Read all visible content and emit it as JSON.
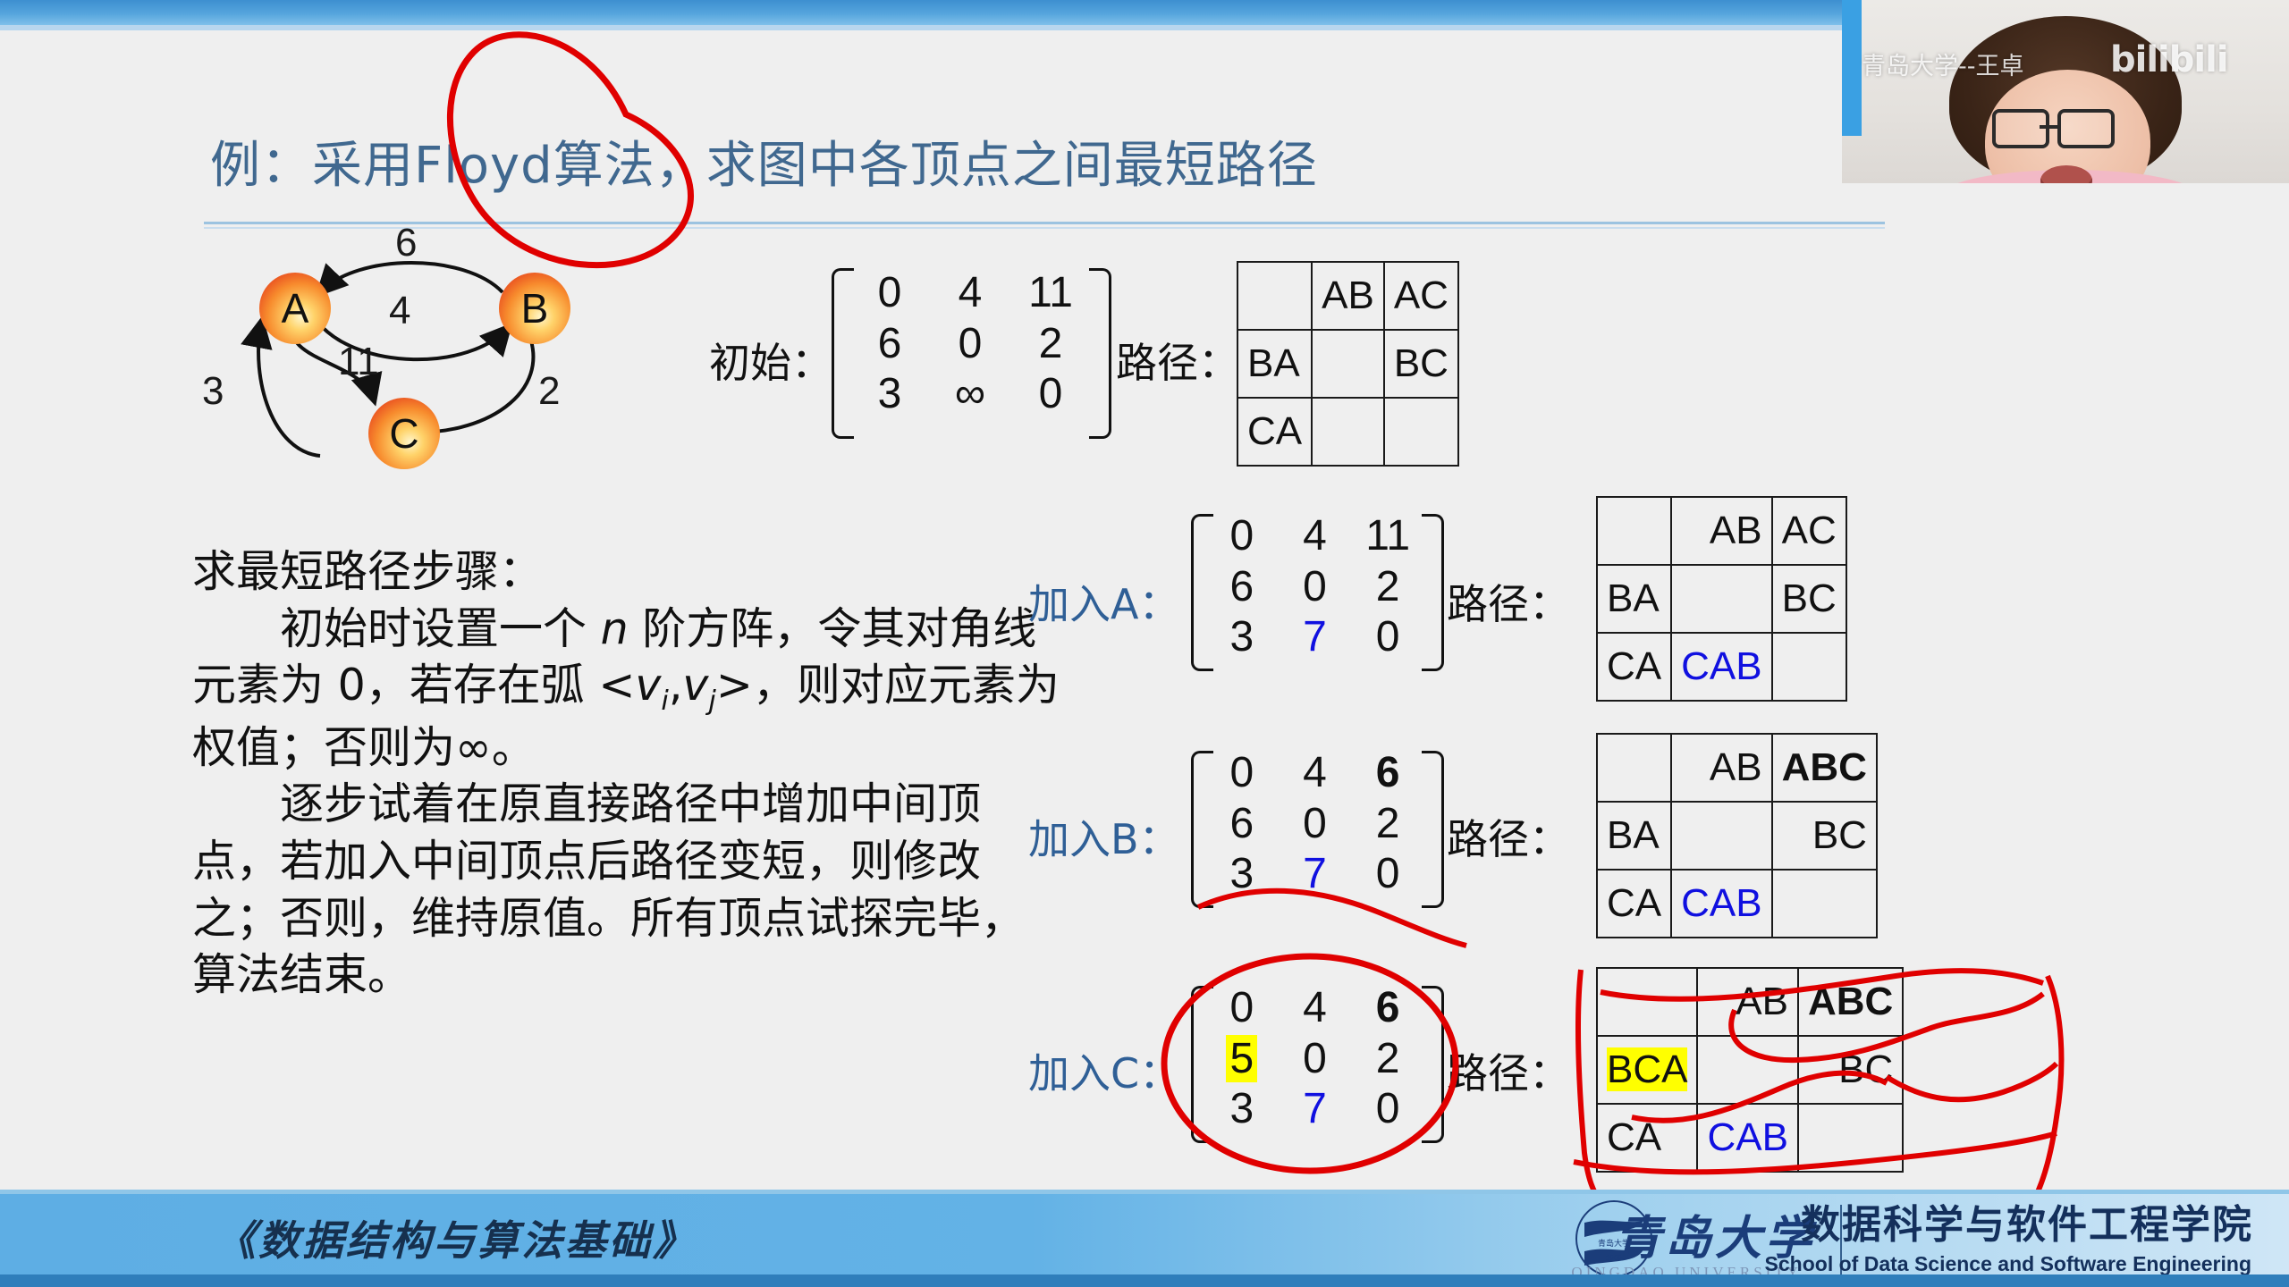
{
  "slide": {
    "title": "例：采用Floyd算法，求图中各顶点之间最短路径",
    "footer_title": "《数据结构与算法基础》",
    "university_cn": "青岛大学",
    "university_en": "QINGDAO UNIVERSITY",
    "school_cn": "数据科学与软件工程学院",
    "school_en": "School of Data Science and Software Engineering"
  },
  "webcam": {
    "watermark": "青岛大学--王卓",
    "platform_logo": "bilibili"
  },
  "graph": {
    "nodes": [
      "A",
      "B",
      "C"
    ],
    "edge_weights": [
      "6",
      "4",
      "11",
      "3",
      "2"
    ],
    "edges": [
      {
        "from": "B",
        "to": "A",
        "weight": "6"
      },
      {
        "from": "A",
        "to": "B",
        "weight": "4"
      },
      {
        "from": "A",
        "to": "C",
        "weight": "11"
      },
      {
        "from": "C",
        "to": "A",
        "weight": "3"
      },
      {
        "from": "B",
        "to": "C",
        "weight": "2"
      }
    ]
  },
  "body": {
    "heading": "求最短路径步骤：",
    "para1_a": "初始时设置一个",
    "para1_n": "n",
    "para1_b": "阶方阵，令其对角线元素为 0，若存在弧 <",
    "para1_vi": "v",
    "para1_isub": "i",
    "para1_comma": ",",
    "para1_vj": "v",
    "para1_jsub": "j",
    "para1_c": ">，则对应元素为权值；否则为∞。",
    "para2": "逐步试着在原直接路径中增加中间顶点，若加入中间顶点后路径变短，则修改之；否则，维持原值。所有顶点试探完毕，算法结束。"
  },
  "steps": [
    {
      "label": "初始：",
      "label_color": "black",
      "path_word": "路径：",
      "matrix": [
        [
          {
            "v": "0",
            "s": ""
          },
          {
            "v": "4",
            "s": ""
          },
          {
            "v": "11",
            "s": ""
          }
        ],
        [
          {
            "v": "6",
            "s": ""
          },
          {
            "v": "0",
            "s": ""
          },
          {
            "v": "2",
            "s": ""
          }
        ],
        [
          {
            "v": "3",
            "s": ""
          },
          {
            "v": "∞",
            "s": ""
          },
          {
            "v": "0",
            "s": ""
          }
        ]
      ],
      "table": [
        [
          {
            "v": "",
            "s": ""
          },
          {
            "v": "AB",
            "s": ""
          },
          {
            "v": "AC",
            "s": ""
          }
        ],
        [
          {
            "v": "BA",
            "s": ""
          },
          {
            "v": "",
            "s": ""
          },
          {
            "v": "BC",
            "s": ""
          }
        ],
        [
          {
            "v": "CA",
            "s": ""
          },
          {
            "v": "",
            "s": ""
          },
          {
            "v": "",
            "s": ""
          }
        ]
      ]
    },
    {
      "label": "加入A：",
      "label_color": "blue",
      "path_word": "路径：",
      "matrix": [
        [
          {
            "v": "0",
            "s": ""
          },
          {
            "v": "4",
            "s": ""
          },
          {
            "v": "11",
            "s": ""
          }
        ],
        [
          {
            "v": "6",
            "s": ""
          },
          {
            "v": "0",
            "s": ""
          },
          {
            "v": "2",
            "s": ""
          }
        ],
        [
          {
            "v": "3",
            "s": ""
          },
          {
            "v": "7",
            "s": "blue"
          },
          {
            "v": "0",
            "s": ""
          }
        ]
      ],
      "table": [
        [
          {
            "v": "",
            "s": ""
          },
          {
            "v": "AB",
            "s": ""
          },
          {
            "v": "AC",
            "s": ""
          }
        ],
        [
          {
            "v": "BA",
            "s": ""
          },
          {
            "v": "",
            "s": ""
          },
          {
            "v": "BC",
            "s": ""
          }
        ],
        [
          {
            "v": "CA",
            "s": ""
          },
          {
            "v": "CAB",
            "s": "blue"
          },
          {
            "v": "",
            "s": ""
          }
        ]
      ]
    },
    {
      "label": "加入B：",
      "label_color": "blue",
      "path_word": "路径：",
      "matrix": [
        [
          {
            "v": "0",
            "s": ""
          },
          {
            "v": "4",
            "s": ""
          },
          {
            "v": "6",
            "s": "bold"
          }
        ],
        [
          {
            "v": "6",
            "s": ""
          },
          {
            "v": "0",
            "s": ""
          },
          {
            "v": "2",
            "s": ""
          }
        ],
        [
          {
            "v": "3",
            "s": ""
          },
          {
            "v": "7",
            "s": "blue"
          },
          {
            "v": "0",
            "s": ""
          }
        ]
      ],
      "table": [
        [
          {
            "v": "",
            "s": ""
          },
          {
            "v": "AB",
            "s": ""
          },
          {
            "v": "ABC",
            "s": "bold"
          }
        ],
        [
          {
            "v": "BA",
            "s": ""
          },
          {
            "v": "",
            "s": ""
          },
          {
            "v": "BC",
            "s": ""
          }
        ],
        [
          {
            "v": "CA",
            "s": ""
          },
          {
            "v": "CAB",
            "s": "blue"
          },
          {
            "v": "",
            "s": ""
          }
        ]
      ]
    },
    {
      "label": "加入C：",
      "label_color": "blue",
      "path_word": "路径：",
      "matrix": [
        [
          {
            "v": "0",
            "s": ""
          },
          {
            "v": "4",
            "s": ""
          },
          {
            "v": "6",
            "s": "bold"
          }
        ],
        [
          {
            "v": "5",
            "s": "hl"
          },
          {
            "v": "0",
            "s": ""
          },
          {
            "v": "2",
            "s": ""
          }
        ],
        [
          {
            "v": "3",
            "s": ""
          },
          {
            "v": "7",
            "s": "blue"
          },
          {
            "v": "0",
            "s": ""
          }
        ]
      ],
      "table": [
        [
          {
            "v": "",
            "s": ""
          },
          {
            "v": "AB",
            "s": ""
          },
          {
            "v": "ABC",
            "s": "bold"
          }
        ],
        [
          {
            "v": "BCA",
            "s": "hl"
          },
          {
            "v": "",
            "s": ""
          },
          {
            "v": "BC",
            "s": ""
          }
        ],
        [
          {
            "v": "CA",
            "s": ""
          },
          {
            "v": "CAB",
            "s": "blue"
          },
          {
            "v": "",
            "s": ""
          }
        ]
      ]
    }
  ],
  "colors": {
    "title": "#40688f",
    "accent_blue": "#1010e0",
    "highlight": "#ffff00",
    "ink_red": "#e00000",
    "bar_blue": "#3d8fd0"
  },
  "annotations": {
    "ink_color": "#e00000",
    "marks": [
      "circle-over-title",
      "circle-over-last-matrix",
      "scribble-over-last-table"
    ]
  }
}
